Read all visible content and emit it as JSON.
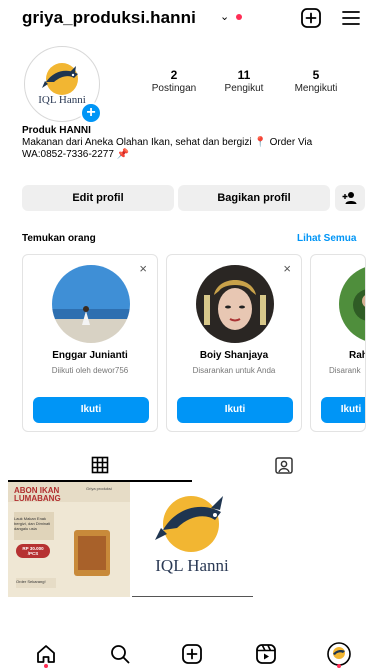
{
  "header": {
    "username": "griya_produksi.hanni",
    "chevron_glyph": "⌄"
  },
  "profile": {
    "avatar_text": "IQL Hanni",
    "stats": [
      {
        "value": "2",
        "label": "Postingan"
      },
      {
        "value": "11",
        "label": "Pengikut"
      },
      {
        "value": "5",
        "label": "Mengikuti"
      }
    ],
    "bio_name": "Produk HANNI",
    "bio_text": "Makanan dari Aneka Olahan Ikan, sehat dan bergizi 📍 Order Via WA:0852-7336-2277 📌"
  },
  "actions": {
    "edit_label": "Edit profil",
    "share_label": "Bagikan profil"
  },
  "discover": {
    "title": "Temukan orang",
    "see_all": "Lihat Semua",
    "close_glyph": "×",
    "cards": [
      {
        "name": "Enggar Junianti",
        "sub": "Diikuti oleh dewor756",
        "follow": "Ikuti"
      },
      {
        "name": "Boiy Shanjaya",
        "sub": "Disarankan untuk Anda",
        "follow": "Ikuti"
      },
      {
        "name": "Rahi",
        "sub": "Disarank",
        "follow": "Ikuti"
      }
    ]
  },
  "posts": {
    "post1": {
      "title": "ABON IKAN LUMABANG",
      "tag": "Griya produksi",
      "desc": "Lauk Makan Enak bergizi, dan Diminati dangalu usia",
      "price": "RP 30.000 /PCS",
      "order": "Order Sekarang!"
    },
    "post2": {
      "brand": "IQL Hanni"
    }
  },
  "colors": {
    "accent": "#0095f6",
    "badge_red": "#ff2d55",
    "button_gray": "#efefef"
  },
  "icons": [
    "plus-square-icon",
    "menu-icon",
    "add-person-icon",
    "grid-icon",
    "tagged-icon",
    "home-icon",
    "search-icon",
    "create-icon",
    "reels-icon",
    "profile-avatar-icon"
  ]
}
